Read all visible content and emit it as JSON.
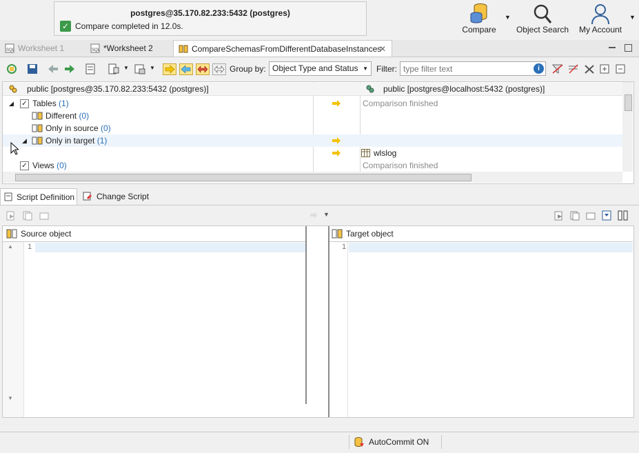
{
  "notification": {
    "title": "postgres@35.170.82.233:5432 (postgres)",
    "message": "Compare completed in 12.0s."
  },
  "top_toolbar": {
    "compare": "Compare",
    "object_search": "Object Search",
    "my_account": "My Account"
  },
  "tabs": [
    {
      "label": "Worksheet 1"
    },
    {
      "label": "*Worksheet 2"
    },
    {
      "label": "CompareSchemasFromDifferentDatabaseInstances"
    }
  ],
  "toolbar": {
    "group_by_label": "Group by:",
    "group_by_value": "Object Type and Status",
    "filter_label": "Filter:",
    "filter_placeholder": "type filter text"
  },
  "tree": {
    "source_header": "public [postgres@35.170.82.233:5432 (postgres)]",
    "target_header": "public [postgres@localhost:5432 (postgres)]",
    "rows": [
      {
        "label": "Tables",
        "count": "(1)",
        "status": "Comparison finished"
      },
      {
        "label": "Different",
        "count": "(0)"
      },
      {
        "label": "Only in source",
        "count": "(0)"
      },
      {
        "label": "Only in target",
        "count": "(1)"
      },
      {
        "target_object": "wlslog"
      },
      {
        "label": "Views",
        "count": "(0)",
        "status": "Comparison finished"
      }
    ]
  },
  "bottom_tabs": {
    "script_definition": "Script Definition",
    "change_script": "Change Script"
  },
  "editors": {
    "source_title": "Source object",
    "target_title": "Target object",
    "source_line": "1",
    "target_line": "1"
  },
  "statusbar": {
    "autocommit": "AutoCommit ON"
  },
  "colors": {
    "accent_blue": "#2a6fb7",
    "status_green": "#3c9a4a",
    "arrow_yellow": "#f2c200"
  }
}
